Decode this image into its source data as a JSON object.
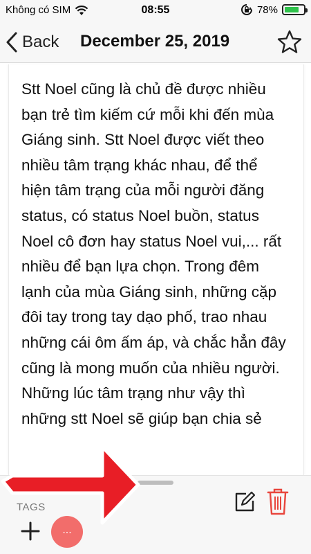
{
  "status_bar": {
    "carrier": "Không có SIM",
    "time": "08:55",
    "battery_percent": "78%",
    "battery_level": 0.78,
    "battery_color": "#2ec24b"
  },
  "nav": {
    "back_label": "Back",
    "title": "December 25, 2019",
    "star_icon": "star-outline-icon"
  },
  "note": {
    "text": "Stt Noel cũng là chủ đề được nhiều bạn trẻ tìm kiếm cứ mỗi khi đến mùa Giáng sinh. Stt Noel được viết theo nhiều tâm trạng khác nhau, để thể hiện tâm trạng của mỗi người đăng status, có status Noel buồn, status Noel cô đơn hay status Noel vui,... rất nhiều để bạn lựa chọn. Trong đêm lạnh của mùa Giáng sinh, những cặp đôi tay trong tay dạo phố, trao nhau những cái ôm ấm áp, và chắc hẳn đây cũng là mong muốn của nhiều người. Những lúc tâm trạng như vậy thì những stt Noel sẽ giúp bạn chia sẻ"
  },
  "bottom": {
    "tags_label": "TAGS",
    "more_label": "...",
    "accent_color": "#f26d6b",
    "trash_color": "#e8463d"
  }
}
